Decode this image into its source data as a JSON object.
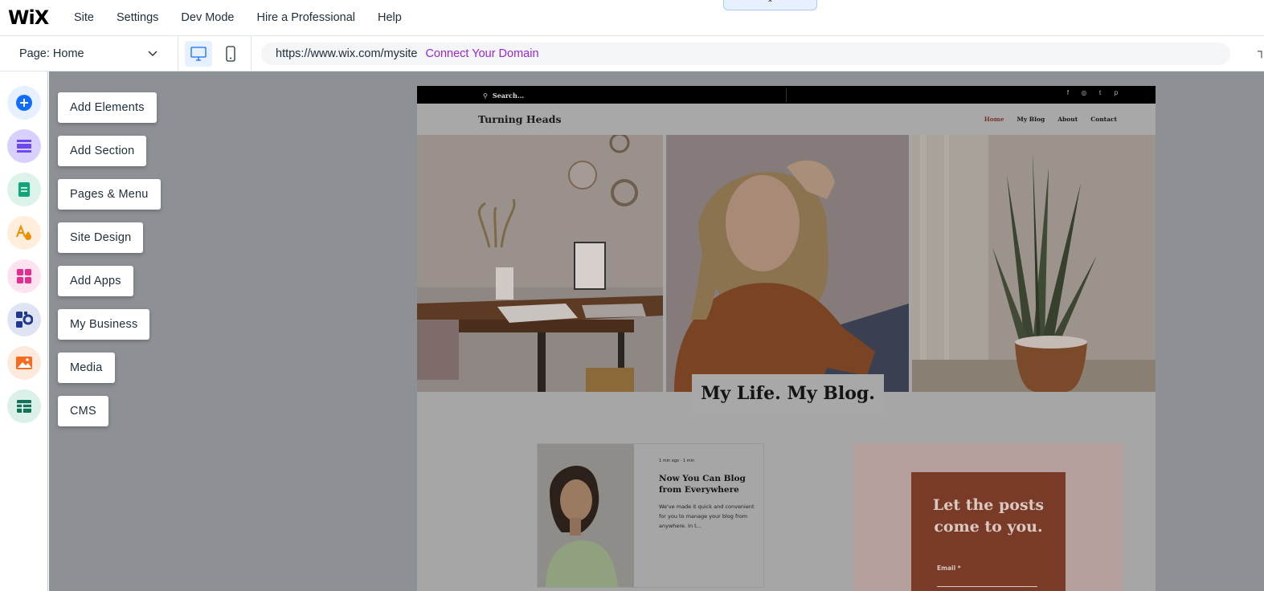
{
  "app": {
    "logo": "WiX",
    "menu": [
      "Site",
      "Settings",
      "Dev Mode",
      "Hire a Professional",
      "Help"
    ],
    "collapse_glyph": "⌃"
  },
  "toolbar": {
    "page_label": "Page: Home",
    "url": "https://www.wix.com/mysite",
    "connect_domain": "Connect Your Domain"
  },
  "rail": {
    "items": [
      {
        "icon": "plus-icon",
        "label": "Add Elements",
        "color": "#116dff",
        "bg": "#e7f0ff"
      },
      {
        "icon": "section-icon",
        "label": "Add Section",
        "color": "#6c48ef",
        "bg": "#d9d0ff"
      },
      {
        "icon": "pages-icon",
        "label": "Pages & Menu",
        "color": "#12a579",
        "bg": "#dcf3ea"
      },
      {
        "icon": "design-icon",
        "label": "Site Design",
        "color": "#f08c00",
        "bg": "#ffeedb"
      },
      {
        "icon": "apps-icon",
        "label": "Add Apps",
        "color": "#e52d90",
        "bg": "#fde3f0"
      },
      {
        "icon": "business-icon",
        "label": "My Business",
        "color": "#21388f",
        "bg": "#dfe4f3"
      },
      {
        "icon": "media-icon",
        "label": "Media",
        "color": "#f56b1f",
        "bg": "#feeadc"
      },
      {
        "icon": "cms-icon",
        "label": "CMS",
        "color": "#12735a",
        "bg": "#dcf0ea"
      }
    ]
  },
  "site": {
    "search_placeholder": "Search...",
    "social": [
      "f",
      "◎",
      "t",
      "p"
    ],
    "brand": "Turning Heads",
    "nav": [
      "Home",
      "My Blog",
      "About",
      "Contact"
    ],
    "hero_title": "My Life. My Blog.",
    "post": {
      "meta": "1 min ago  ·  1 min",
      "title": "Now You Can Blog from Everywhere",
      "excerpt": "We've made it quick and convenient for you to manage your blog from anywhere. In t..."
    },
    "subscribe": {
      "title": "Let the posts come to you.",
      "email_label": "Email *"
    }
  }
}
